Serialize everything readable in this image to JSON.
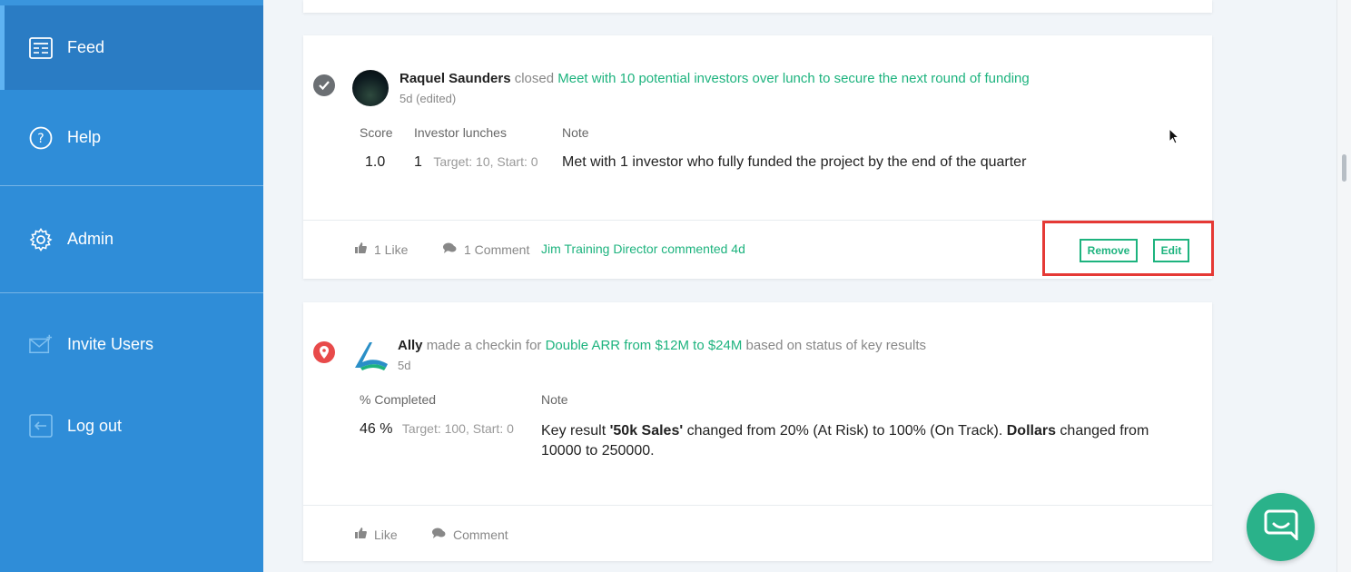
{
  "sidebar": {
    "items": [
      {
        "label": "Feed",
        "icon": "feed-icon",
        "active": true
      },
      {
        "label": "Help",
        "icon": "help-icon"
      },
      {
        "label": "Admin",
        "icon": "gear-icon"
      },
      {
        "label": "Invite Users",
        "icon": "envelope-plus-icon"
      },
      {
        "label": "Log out",
        "icon": "logout-icon"
      }
    ]
  },
  "posts": [
    {
      "status_icon": "check-icon",
      "author": "Raquel Saunders",
      "verb": "closed",
      "target": "Meet with 10 potential investors over lunch to secure the next round of funding",
      "time": "5d (edited)",
      "columns": {
        "score_header": "Score",
        "score": "1.0",
        "metric_header": "Investor lunches",
        "metric_value": "1",
        "metric_detail": "Target: 10, Start: 0",
        "note_header": "Note",
        "note": "Met with 1 investor who fully funded the project by the end of the quarter"
      },
      "footer": {
        "like": "1 Like",
        "comment": "1 Comment",
        "activity": "Jim Training Director commented 4d",
        "remove": "Remove",
        "edit": "Edit"
      }
    },
    {
      "status_icon": "location-pin-icon",
      "author": "Ally",
      "verb": "made a checkin for",
      "target": "Double ARR from $12M to $24M",
      "suffix": "based on status of key results",
      "time": "5d",
      "columns": {
        "metric_header": "% Completed",
        "metric_value": "46 %",
        "metric_detail": "Target: 100, Start: 0",
        "note_header": "Note",
        "note_part1": "Key result ",
        "note_bold1": "'50k Sales'",
        "note_part2": " changed from 20% (At Risk) to 100% (On Track). ",
        "note_bold2": "Dollars",
        "note_part3": " changed from",
        "note_line2": "10000 to 250000."
      },
      "footer": {
        "like": "Like",
        "comment": "Comment"
      }
    }
  ],
  "colors": {
    "sidebar": "#2f8dd8",
    "accent": "#1db37e",
    "highlight": "#e53935",
    "chat": "#2ab28a"
  }
}
